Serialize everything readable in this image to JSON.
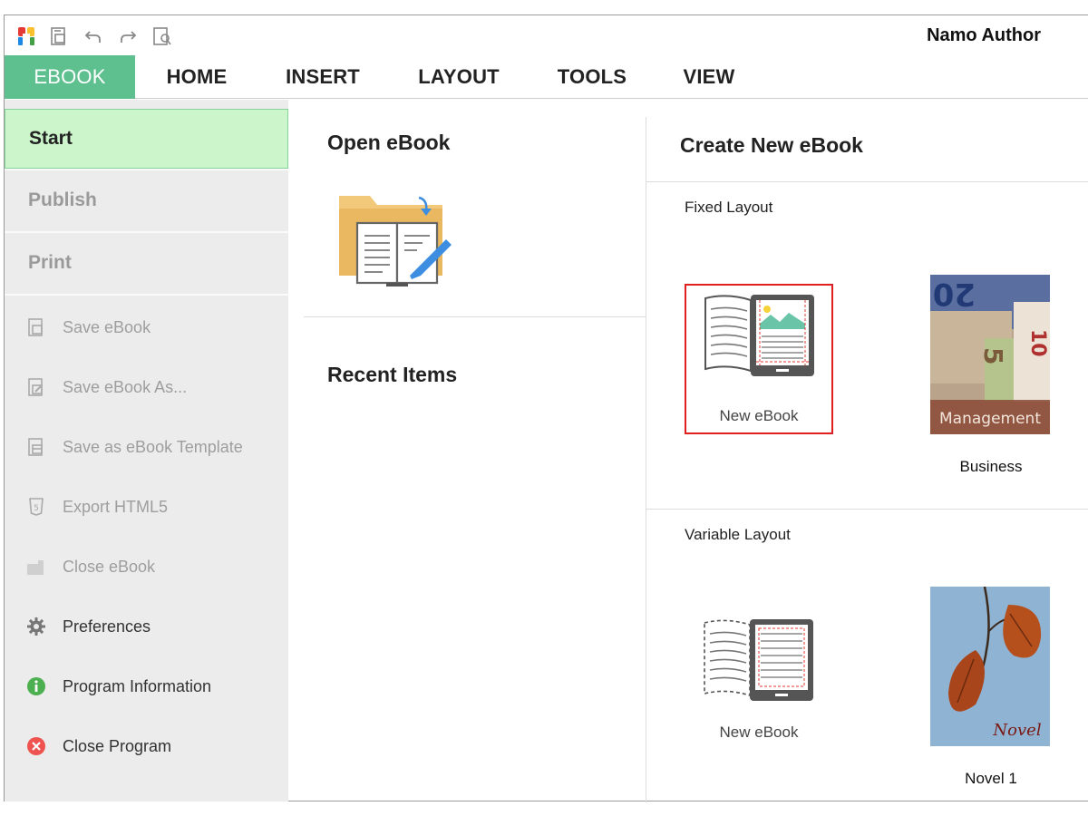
{
  "app": {
    "title": "Namo Author"
  },
  "quick_access": [
    "app-logo-icon",
    "save-icon",
    "undo-icon",
    "redo-icon",
    "print-preview-icon"
  ],
  "tabs": [
    {
      "label": "EBOOK",
      "active": true
    },
    {
      "label": "HOME"
    },
    {
      "label": "INSERT"
    },
    {
      "label": "LAYOUT"
    },
    {
      "label": "TOOLS"
    },
    {
      "label": "VIEW"
    }
  ],
  "sidebar": {
    "sections": [
      {
        "label": "Start",
        "active": true
      },
      {
        "label": "Publish"
      },
      {
        "label": "Print"
      }
    ],
    "items": [
      {
        "label": "Save eBook",
        "icon": "save-icon",
        "enabled": false
      },
      {
        "label": "Save eBook As...",
        "icon": "save-as-icon",
        "enabled": false
      },
      {
        "label": "Save as eBook Template",
        "icon": "save-template-icon",
        "enabled": false
      },
      {
        "label": "Export HTML5",
        "icon": "html5-icon",
        "enabled": false
      },
      {
        "label": "Close eBook",
        "icon": "close-ebook-icon",
        "enabled": false
      },
      {
        "label": "Preferences",
        "icon": "gear-icon",
        "enabled": true
      },
      {
        "label": "Program Information",
        "icon": "info-icon",
        "enabled": true
      },
      {
        "label": "Close Program",
        "icon": "close-circle-icon",
        "enabled": true
      }
    ]
  },
  "open_panel": {
    "title": "Open eBook",
    "recent_title": "Recent Items"
  },
  "create_panel": {
    "title": "Create New eBook",
    "fixed": {
      "label": "Fixed Layout",
      "templates": [
        {
          "caption": "New eBook",
          "selected": true
        },
        {
          "caption": "Business",
          "cover_text": "Management"
        }
      ]
    },
    "variable": {
      "label": "Variable Layout",
      "templates": [
        {
          "caption": "New eBook"
        },
        {
          "caption": "Novel 1",
          "cover_text": "Novel"
        }
      ]
    }
  },
  "colors": {
    "accent_green": "#5fc08f",
    "start_bg": "#ccf5cc",
    "selection_red": "#e02020",
    "sidebar_bg": "#ececec"
  }
}
